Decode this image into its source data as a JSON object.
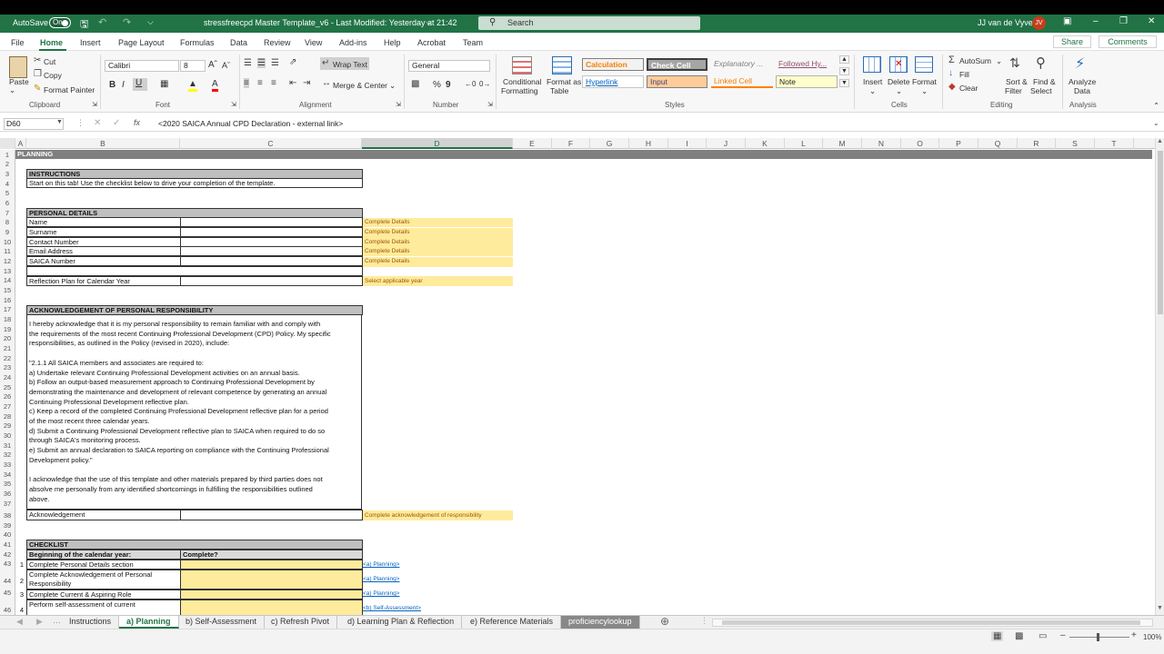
{
  "titlebar": {
    "autosave_label": "AutoSave",
    "autosave_state": "On",
    "doc_title": "stressfreecpd Master Template_v6  -  Last Modified: Yesterday at 21:42",
    "search_placeholder": "Search",
    "user_name": "JJ van de Vyver",
    "user_initials": "JV"
  },
  "menu": {
    "tabs": [
      "File",
      "Home",
      "Insert",
      "Page Layout",
      "Formulas",
      "Data",
      "Review",
      "View",
      "Add-ins",
      "Help",
      "Acrobat",
      "Team"
    ],
    "share": "Share",
    "comments": "Comments"
  },
  "ribbon": {
    "paste": "Paste",
    "cut": "Cut",
    "copy": "Copy",
    "format_painter": "Format Painter",
    "clipboard": "Clipboard",
    "font_name": "Calibri",
    "font_size": "8",
    "font": "Font",
    "wrap_text": "Wrap Text",
    "merge_center": "Merge & Center",
    "alignment": "Alignment",
    "number_format": "General",
    "number": "Number",
    "conditional_formatting": [
      "Conditional",
      "Formatting"
    ],
    "format_as_table": [
      "Format as",
      "Table"
    ],
    "styles_label": "Styles",
    "styles": {
      "calculation": "Calculation",
      "check_cell": "Check Cell",
      "explanatory": "Explanatory ...",
      "followed_hy": "Followed Hy...",
      "hyperlink": "Hyperlink",
      "input": "Input",
      "linked_cell": "Linked Cell",
      "note": "Note"
    },
    "insert": "Insert",
    "delete": "Delete",
    "format": "Format",
    "cells": "Cells",
    "autosum": "AutoSum",
    "fill": "Fill",
    "clear": "Clear",
    "sort_filter": [
      "Sort &",
      "Filter"
    ],
    "find_select": [
      "Find &",
      "Select"
    ],
    "editing": "Editing",
    "analyze_data": [
      "Analyze",
      "Data"
    ],
    "analysis": "Analysis"
  },
  "formula_bar": {
    "name_box": "D60",
    "fx": "fx",
    "formula": "<2020 SAICA Annual CPD Declaration - external link>"
  },
  "columns": [
    "A",
    "B",
    "C",
    "D",
    "E",
    "F",
    "G",
    "H",
    "I",
    "J",
    "K",
    "L",
    "M",
    "N",
    "O",
    "P",
    "Q",
    "R",
    "S",
    "T"
  ],
  "rows": [
    "1",
    "2",
    "3",
    "4",
    "5",
    "6",
    "7",
    "8",
    "9",
    "10",
    "11",
    "12",
    "13",
    "14",
    "15",
    "16",
    "17",
    "18",
    "19",
    "20",
    "21",
    "22",
    "23",
    "24",
    "25",
    "26",
    "27",
    "28",
    "29",
    "30",
    "31",
    "32",
    "33",
    "34",
    "35",
    "36",
    "37",
    "38",
    "39",
    "40",
    "41",
    "42",
    "43",
    "44",
    "45",
    "46"
  ],
  "sheet": {
    "planning": "PLANNING",
    "instructions_hdr": "INSTRUCTIONS",
    "instructions_text": "Start on this tab! Use the checklist below to drive your completion of the template.",
    "personal_hdr": "PERSONAL DETAILS",
    "personal_fields": [
      "Name",
      "Surname",
      "Contact Number",
      "Email Address",
      "SAICA Number"
    ],
    "complete_details": "Complete Details",
    "reflection_label": "Reflection Plan for Calendar Year",
    "select_year": "Select applicable year",
    "ack_hdr": "ACKNOWLEDGEMENT OF PERSONAL RESPONSIBILITY",
    "ack_lines": [
      "I hereby acknowledge that it is my personal responsibility to remain familiar with and comply with",
      "the requirements of the most recent Continuing Professional Development (CPD) Policy. My specific",
      "responsibilities, as outlined in the Policy (revised in 2020), include:",
      "",
      "\"2.1.1 All SAICA members and associates are required to:",
      "a) Undertake relevant Continuing Professional Development activities on an annual basis.",
      "b) Follow an output-based measurement approach to Continuing Professional Development by",
      "demonstrating the maintenance and development of relevant competence by generating an annual",
      "Continuing Professional Development reflective plan.",
      "c) Keep a record of the completed Continuing Professional Development reflective plan for a period",
      "of the most recent three calendar years.",
      "d) Submit a Continuing Professional Development reflective plan to SAICA when required to do so",
      "through SAICA's monitoring process.",
      "e) Submit an annual declaration to SAICA reporting on compliance with the Continuing Professional",
      "Development policy.\"",
      "",
      "I acknowledge that the use of this template and other materials prepared by third parties does not",
      "absolve me personally from any identified shortcomings in fulfilling the responsibilities outlined",
      "above."
    ],
    "ack_label": "Acknowledgement",
    "ack_note": "Complete acknowledgement of responsibility",
    "checklist_hdr": "CHECKLIST",
    "checklist_col1": "Beginning of the calendar year:",
    "checklist_col2": "Complete?",
    "checklist_items": [
      {
        "num": "1",
        "text": "Complete Personal Details section",
        "link": "<a) Planning>"
      },
      {
        "num": "2",
        "text": "Complete Acknowledgement of Personal Responsibility",
        "link": "<a) Planning>"
      },
      {
        "num": "3",
        "text": "Complete Current & Aspiring Role",
        "link": "<a) Planning>"
      },
      {
        "num": "4",
        "text": "Perform self-assessment of current",
        "link": "<b) Self-Assessment>"
      }
    ]
  },
  "sheet_tabs": [
    "Instructions",
    "a) Planning",
    "b) Self-Assessment",
    "c) Refresh Pivot",
    "d) Learning Plan & Reflection",
    "e) Reference Materials",
    "proficiencylookup"
  ],
  "status": {
    "zoom": "100%"
  }
}
